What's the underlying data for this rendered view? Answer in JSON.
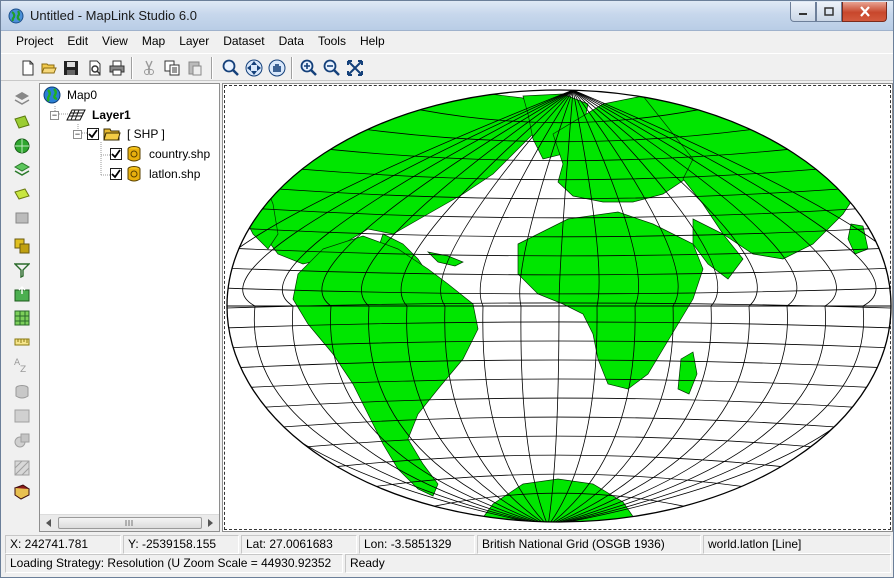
{
  "window": {
    "title": "Untitled - MapLink Studio 6.0"
  },
  "menu": [
    "Project",
    "Edit",
    "View",
    "Map",
    "Layer",
    "Dataset",
    "Data",
    "Tools",
    "Help"
  ],
  "tree": {
    "root": "Map0",
    "layer": "Layer1",
    "group": "[ SHP ]",
    "files": [
      "country.shp",
      "latlon.shp"
    ]
  },
  "status": {
    "x": "X: 242741.781",
    "y": "Y: -2539158.155",
    "lat": "Lat: 27.0061683",
    "lon": "Lon: -3.5851329",
    "projection": "British National Grid (OSGB 1936)",
    "dataset": "world.latlon [Line]",
    "loading": "Loading Strategy: Resolution (U Zoom Scale = 44930.92352",
    "ready": "Ready"
  },
  "colors": {
    "land": "#00e600",
    "ocean": "#ffffff",
    "graticule": "#000000"
  }
}
